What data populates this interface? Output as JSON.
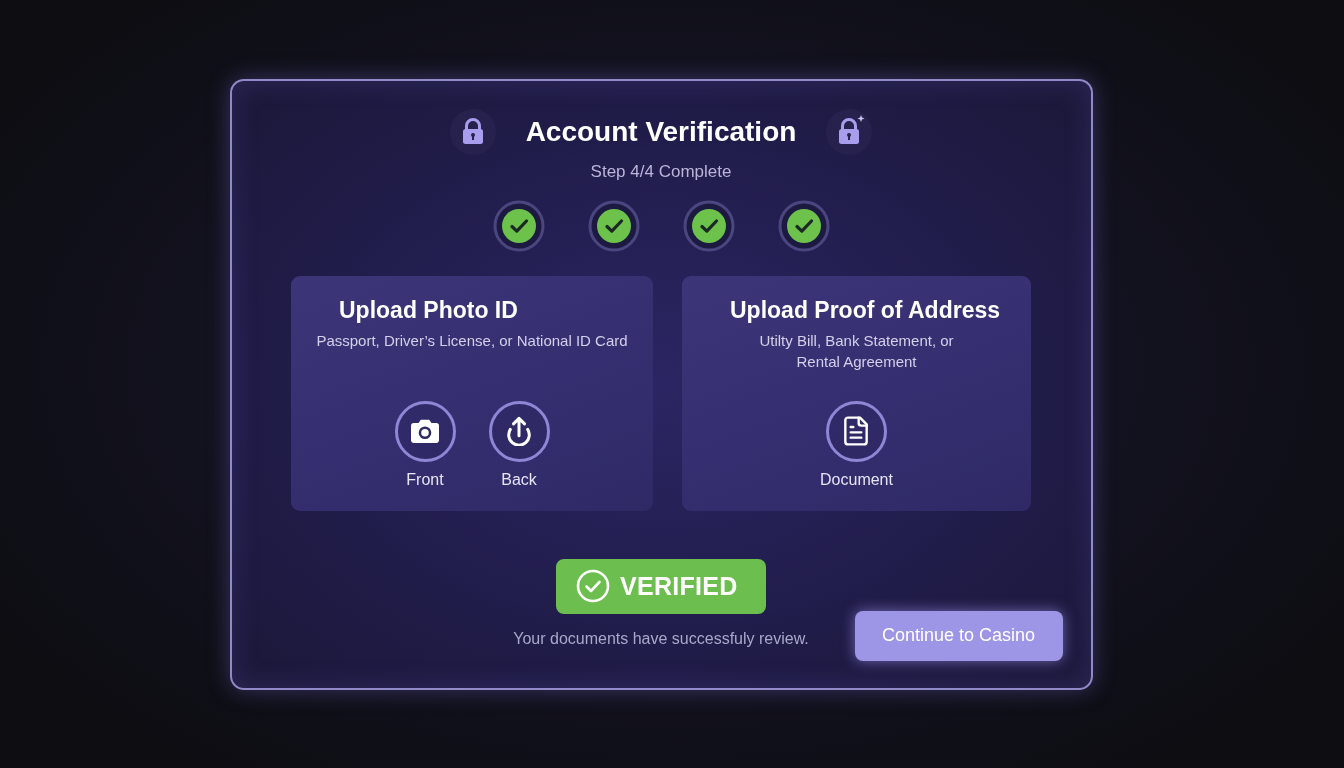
{
  "header": {
    "title": "Account Verification",
    "subtitle": "Step 4/4 Complete"
  },
  "steps": [
    {
      "complete": true
    },
    {
      "complete": true
    },
    {
      "complete": true
    },
    {
      "complete": true
    }
  ],
  "panels": [
    {
      "title": "Upload Photo ID",
      "description": "Passport, Driver’s License, or National ID Card",
      "uploads": [
        {
          "kind": "camera",
          "label": "Front"
        },
        {
          "kind": "upload",
          "label": "Back"
        }
      ]
    },
    {
      "title": "Upload Proof of Address",
      "description": "Utilty Bill, Bank Statement, or\nRental Agreement",
      "uploads": [
        {
          "kind": "document",
          "label": "Document"
        }
      ]
    }
  ],
  "status": {
    "badge": "VERIFIED",
    "message": "Your documents have successfuly review."
  },
  "actions": {
    "continue": "Continue to Casino"
  }
}
